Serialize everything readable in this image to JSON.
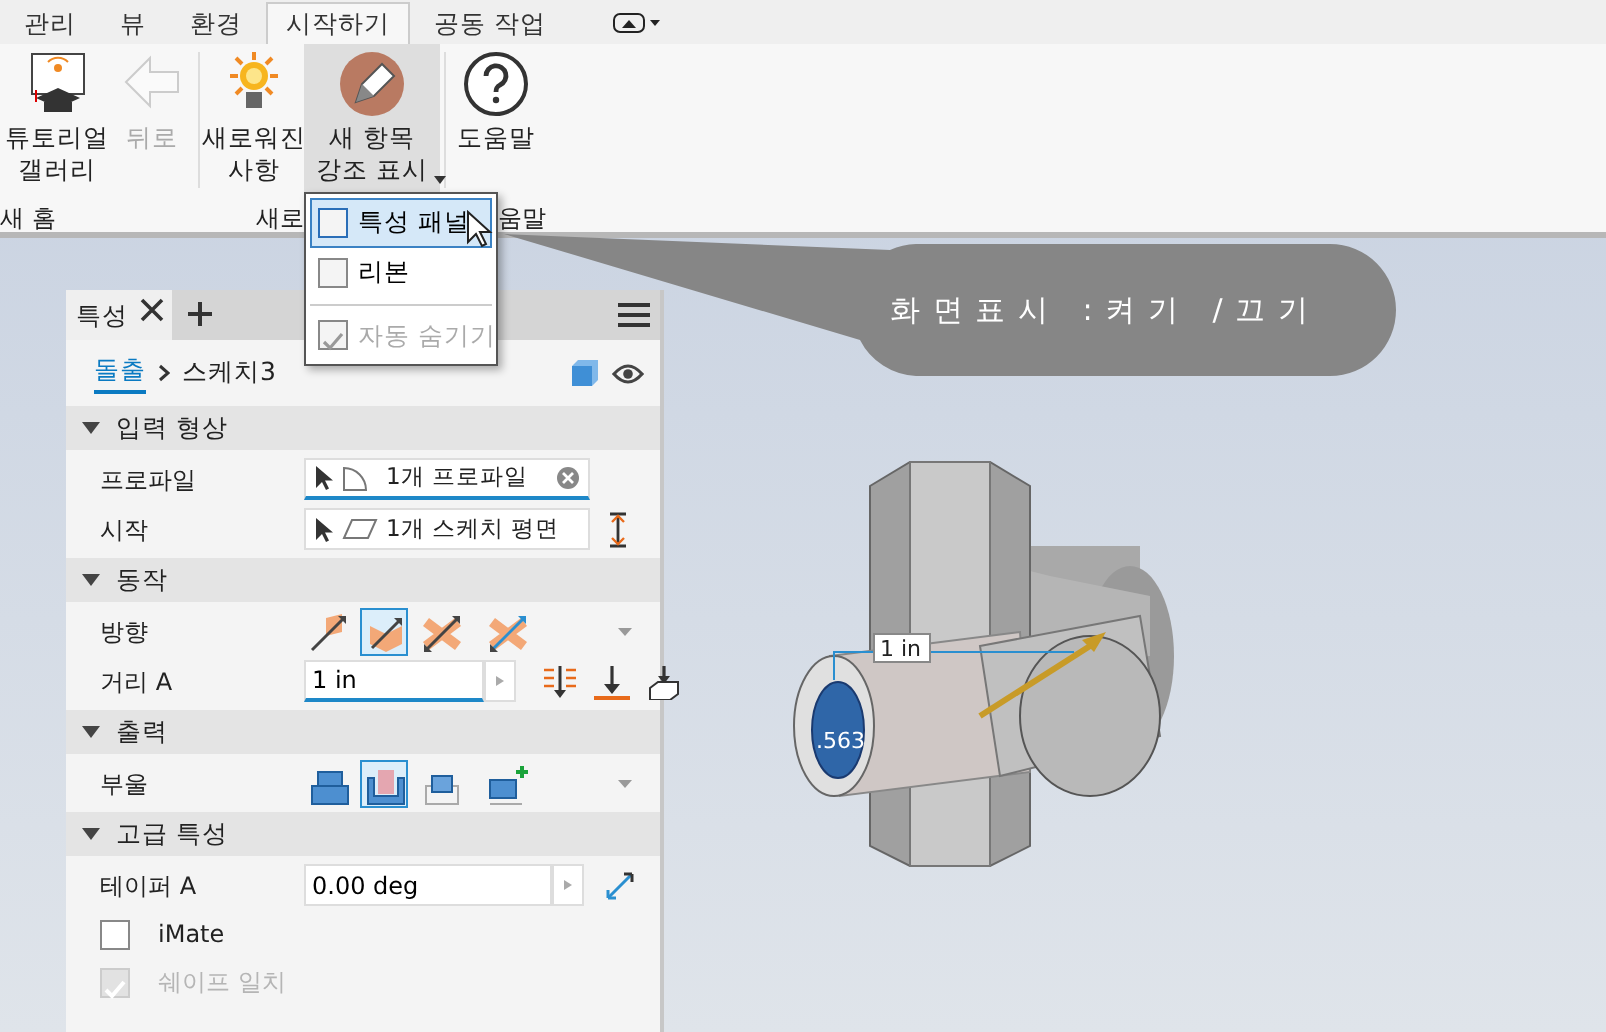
{
  "ribbon_tabs": [
    {
      "label": "관리",
      "selected": false
    },
    {
      "label": "뷰",
      "selected": false
    },
    {
      "label": "환경",
      "selected": false
    },
    {
      "label": "시작하기",
      "selected": true
    },
    {
      "label": "공동 작업",
      "selected": false
    }
  ],
  "ribbon_buttons": [
    {
      "kind": "tutorial",
      "lines": [
        "튜토리얼",
        "갤러리"
      ],
      "disabled": false,
      "pressed": false,
      "dropdown": false
    },
    {
      "kind": "back",
      "lines": [
        "뒤로"
      ],
      "disabled": true,
      "pressed": false,
      "dropdown": false
    },
    {
      "kind": "whatsnew",
      "lines": [
        "새로워진",
        "사항"
      ],
      "disabled": false,
      "pressed": false,
      "dropdown": false
    },
    {
      "kind": "highlight",
      "lines": [
        "새 항목",
        "강조 표시"
      ],
      "disabled": false,
      "pressed": true,
      "dropdown": true
    },
    {
      "kind": "help",
      "lines": [
        "도움말"
      ],
      "disabled": false,
      "pressed": false,
      "dropdown": false
    }
  ],
  "ribbon_groups": [
    "새 홈",
    "새로",
    "움말"
  ],
  "menu": [
    {
      "label": "특성 패널",
      "checked": false,
      "highlighted": true,
      "disabled": false
    },
    {
      "label": "리본",
      "checked": false,
      "highlighted": false,
      "disabled": false
    },
    {
      "label": "자동 숨기기",
      "checked": true,
      "highlighted": false,
      "disabled": true
    }
  ],
  "callout": "화면표시 :켜기 /끄기",
  "panel": {
    "tab": "특성",
    "breadcrumb_link": "돌출",
    "breadcrumb": "스케치3",
    "sections": [
      {
        "title": "입력 형상",
        "expanded": true,
        "rows": [
          {
            "kind": "selector",
            "label": "프로파일",
            "value": "1개 프로파일",
            "focused": true
          },
          {
            "kind": "selector",
            "label": "시작",
            "value": "1개 스케치 평면",
            "focused": false
          }
        ]
      },
      {
        "title": "동작",
        "expanded": true,
        "rows": [
          {
            "kind": "toggles",
            "label": "방향",
            "options": [
              {
                "kind": "default",
                "selected": false
              },
              {
                "kind": "flip",
                "selected": true
              },
              {
                "kind": "symmetric",
                "selected": false
              },
              {
                "kind": "asymmetric",
                "selected": false
              }
            ]
          },
          {
            "kind": "input",
            "label": "거리 A",
            "value": "1 in",
            "focused": true
          }
        ]
      },
      {
        "title": "출력",
        "expanded": true,
        "rows": [
          {
            "kind": "toggles",
            "label": "부울",
            "options": [
              {
                "kind": "join",
                "selected": false
              },
              {
                "kind": "cut",
                "selected": true
              },
              {
                "kind": "intersect",
                "selected": false
              },
              {
                "kind": "newsolid",
                "selected": false
              }
            ]
          }
        ]
      },
      {
        "title": "고급 특성",
        "expanded": true,
        "rows": [
          {
            "kind": "input",
            "label": "테이퍼 A",
            "value": "0.00 deg",
            "focused": false
          },
          {
            "kind": "checkbox",
            "label": "iMate",
            "checked": false,
            "disabled": false
          },
          {
            "kind": "checkbox",
            "label": "쉐이프 일치",
            "checked": true,
            "disabled": true
          }
        ]
      }
    ]
  },
  "viewport": {
    "distance_label": "1 in",
    "diameter_label": ".563"
  }
}
